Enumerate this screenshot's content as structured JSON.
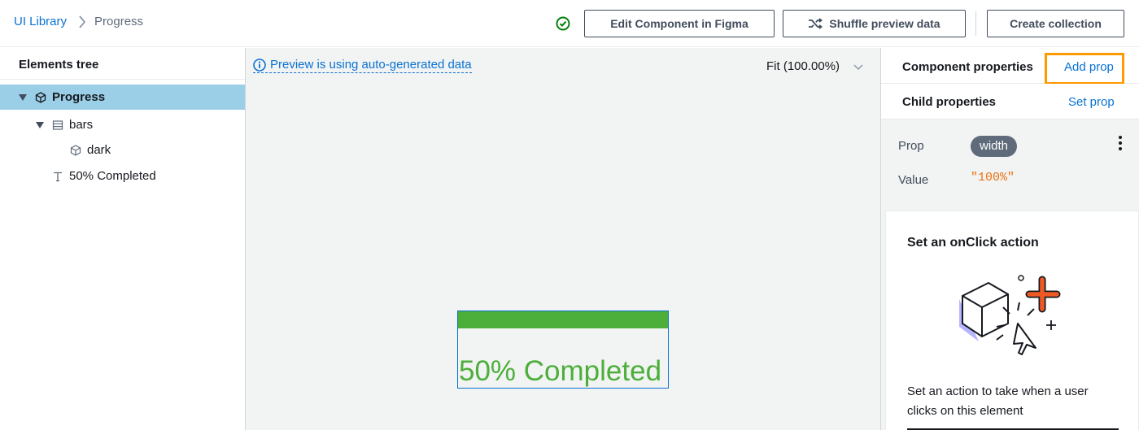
{
  "header": {
    "breadcrumb": {
      "root": "UI Library",
      "current": "Progress"
    },
    "status_icon": "check-circle-icon",
    "buttons": {
      "edit_figma": "Edit Component in Figma",
      "shuffle": "Shuffle preview data",
      "create_collection": "Create collection"
    }
  },
  "left_panel": {
    "title": "Elements tree",
    "tree": [
      {
        "label": "Progress",
        "icon": "component-icon",
        "expanded": true,
        "selected": true
      },
      {
        "label": "bars",
        "icon": "stack-icon",
        "expanded": true,
        "selected": false
      },
      {
        "label": "dark",
        "icon": "component-icon",
        "selected": false
      },
      {
        "label": "50% Completed",
        "icon": "text-icon",
        "selected": false
      }
    ]
  },
  "canvas": {
    "preview_note": "Preview is using auto-generated data",
    "zoom": "Fit (100.00%)",
    "component": {
      "text": "50% Completed",
      "bar_color": "#4caf3a",
      "text_color": "#4caf3a"
    }
  },
  "right_panel": {
    "component_properties": {
      "title": "Component properties",
      "action": "Add prop"
    },
    "child_properties": {
      "title": "Child properties",
      "action": "Set prop"
    },
    "prop": {
      "label": "Prop",
      "name": "width"
    },
    "value": {
      "label": "Value",
      "text": "\"100%\""
    },
    "onclick_card": {
      "title": "Set an onClick action",
      "description": "Set an action to take when a user clicks on this element"
    }
  },
  "colors": {
    "accent": "#0972d3",
    "highlight": "#ff9900",
    "selected_row": "#9bcfe7",
    "value_text": "#ec7211"
  }
}
